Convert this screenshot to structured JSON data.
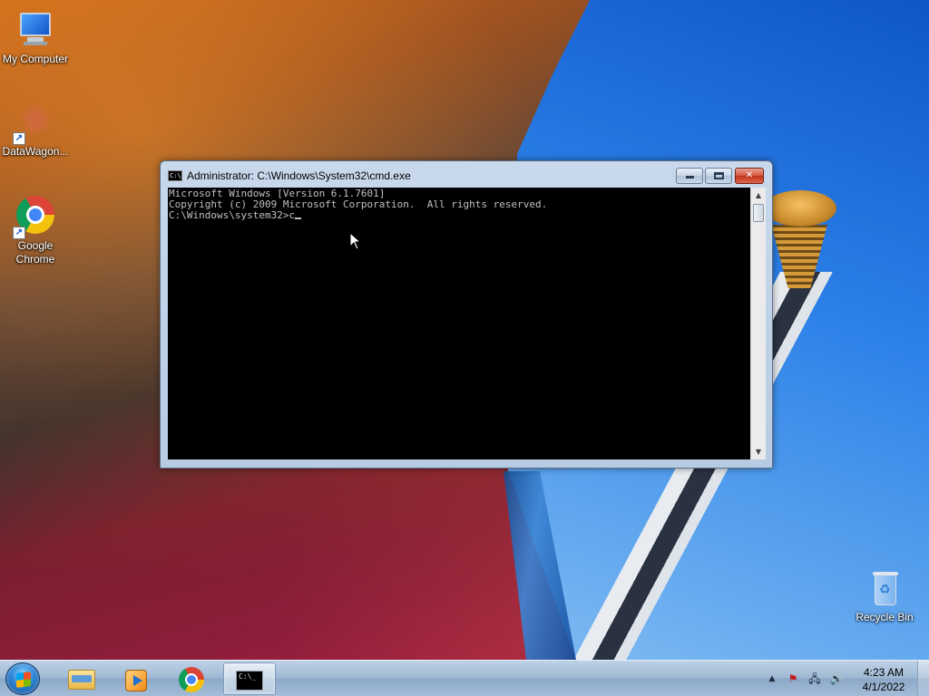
{
  "desktop": {
    "icons": [
      {
        "label": "My Computer"
      },
      {
        "label": "DataWagon..."
      },
      {
        "label": "Google Chrome"
      },
      {
        "label": "Recycle Bin"
      }
    ]
  },
  "cmd_window": {
    "title": "Administrator: C:\\Windows\\System32\\cmd.exe",
    "icon_label": "C:\\",
    "lines": [
      "Microsoft Windows [Version 6.1.7601]",
      "Copyright (c) 2009 Microsoft Corporation.  All rights reserved.",
      "",
      "C:\\Windows\\system32>c"
    ],
    "controls": {
      "close_symbol": "✕"
    }
  },
  "taskbar": {
    "cmd_icon_label": "C:\\_",
    "tray": {
      "show_hidden_symbol": "▲",
      "action_center_symbol": "⚑",
      "network_symbol": "🖧",
      "volume_symbol": "🔊"
    },
    "clock": {
      "time": "4:23 AM",
      "date": "4/1/2022"
    }
  },
  "colors": {
    "console_bg": "#000000",
    "console_fg": "#c0c0c0",
    "close_button": "#c1331a"
  }
}
